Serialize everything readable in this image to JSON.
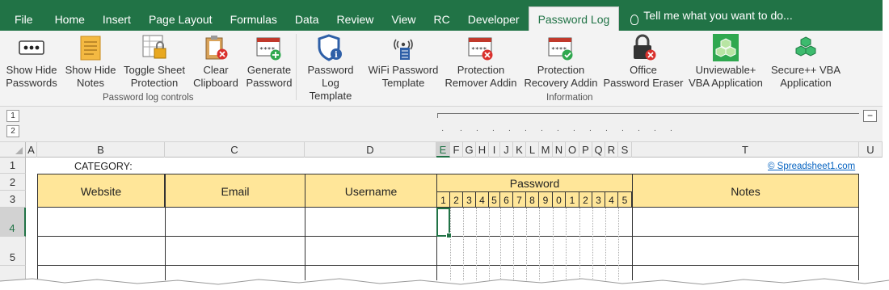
{
  "ribbon_tabs": [
    "File",
    "Home",
    "Insert",
    "Page Layout",
    "Formulas",
    "Data",
    "Review",
    "View",
    "RC",
    "Developer",
    "Password Log"
  ],
  "active_tab": "Password Log",
  "tell_me": "Tell me what you want to do...",
  "buttons": {
    "show_hide_passwords": "Show Hide\nPasswords",
    "show_hide_notes": "Show Hide\nNotes",
    "toggle_sheet_protection": "Toggle Sheet\nProtection",
    "clear_clipboard": "Clear\nClipboard",
    "generate_password": "Generate\nPassword",
    "password_log_template": "Password Log\nTemplate",
    "wifi_password_template": "WiFi Password\nTemplate",
    "protection_remover_addin": "Protection\nRemover Addin",
    "protection_recovery_addin": "Protection\nRecovery Addin",
    "office_password_eraser": "Office\nPassword Eraser",
    "unviewable_vba": "Unviewable+\nVBA Application",
    "secure_vba": "Secure++ VBA\nApplication"
  },
  "group_labels": {
    "password_log_controls": "Password log controls",
    "information": "Information"
  },
  "outline_levels": [
    "1",
    "2"
  ],
  "outline_collapse": "−",
  "columns": [
    "A",
    "B",
    "C",
    "D",
    "E",
    "F",
    "G",
    "H",
    "I",
    "J",
    "K",
    "L",
    "M",
    "N",
    "O",
    "P",
    "Q",
    "R",
    "S",
    "T",
    "U"
  ],
  "rows": [
    "1",
    "2",
    "3",
    "4",
    "5"
  ],
  "sheet": {
    "category_label": "CATEGORY:",
    "link": "© Spreadsheet1.com",
    "headers": {
      "website": "Website",
      "email": "Email",
      "username": "Username",
      "password": "Password",
      "notes": "Notes"
    },
    "password_digits": [
      "1",
      "2",
      "3",
      "4",
      "5",
      "6",
      "7",
      "8",
      "9",
      "0",
      "1",
      "2",
      "3",
      "4",
      "5"
    ]
  },
  "colors": {
    "excel_green": "#217346",
    "header_fill": "#ffe699",
    "link": "#0563c1"
  },
  "icons": [
    "dots-icon",
    "notes-icon",
    "lock-sheet-icon",
    "clipboard-clear-icon",
    "password-add-icon",
    "shield-info-icon",
    "wifi-icon",
    "password-remove-icon",
    "password-check-icon",
    "padlock-remove-icon",
    "cubes-icon",
    "cubes-plus-icon"
  ]
}
